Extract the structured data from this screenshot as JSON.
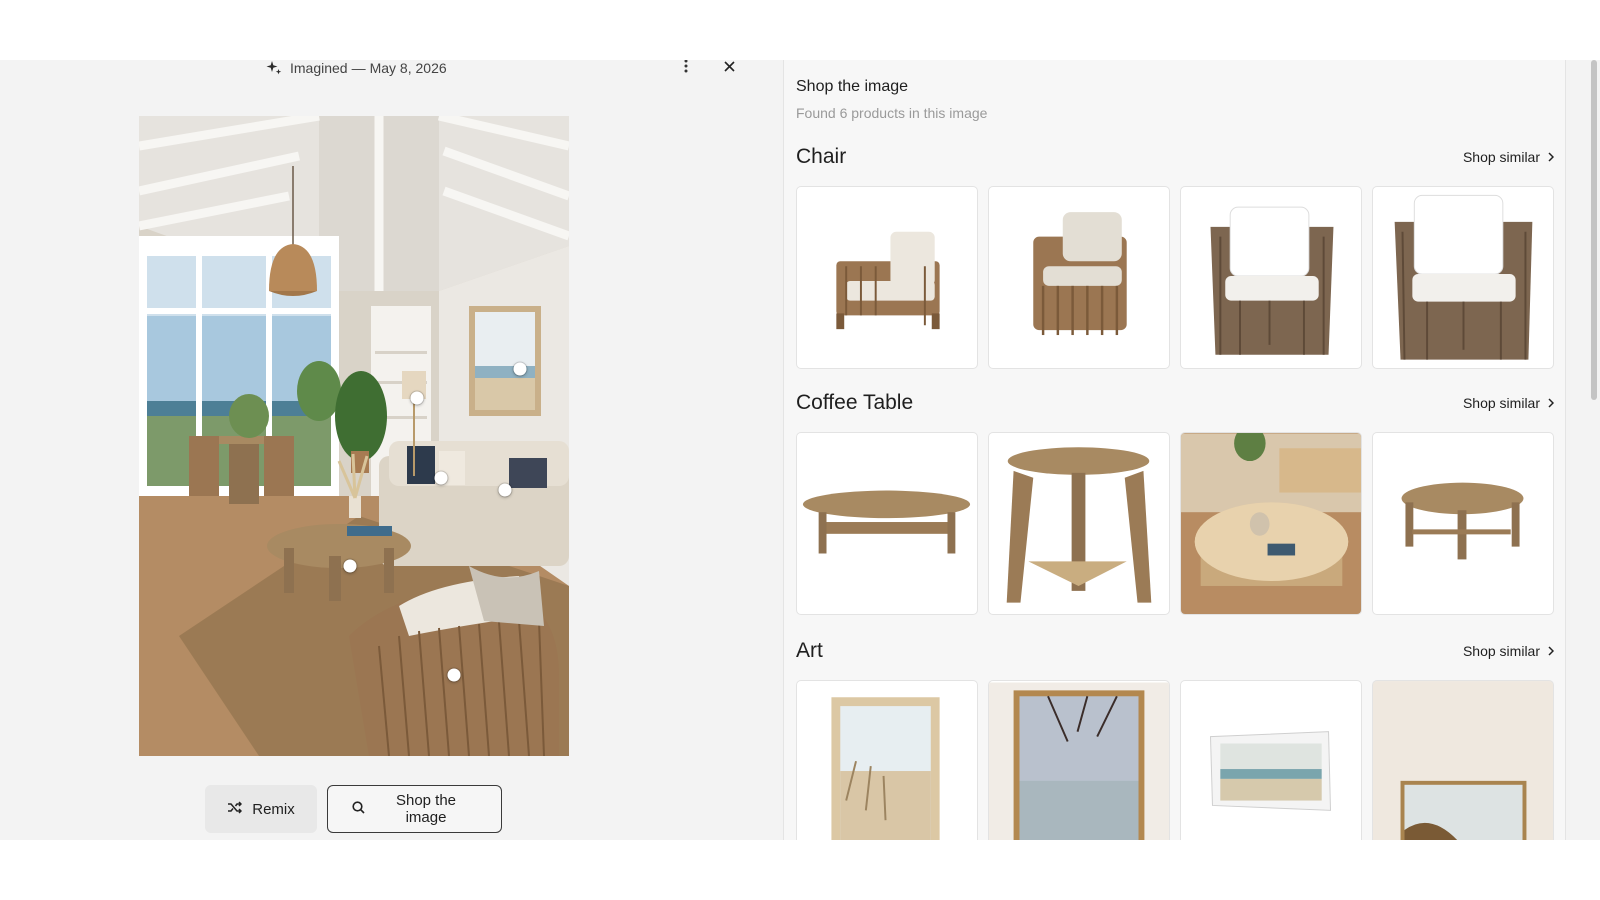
{
  "viewer": {
    "imagined_label": "Imagined",
    "separator": "—",
    "date": "May 8, 2026",
    "more_icon": "more-vertical-icon",
    "close_icon": "close-icon",
    "remix_label": "Remix",
    "remix_icon": "shuffle-icon",
    "shop_label": "Shop the image",
    "shop_icon": "search-icon"
  },
  "panel": {
    "title": "Shop the image",
    "subtitle": "Found 6 products in this image",
    "sections": [
      {
        "title": "Chair",
        "link": "Shop similar",
        "link_icon": "chevron-right-icon"
      },
      {
        "title": "Coffee Table",
        "link": "Shop similar",
        "link_icon": "chevron-right-icon"
      },
      {
        "title": "Art",
        "link": "Shop similar",
        "link_icon": "chevron-right-icon"
      }
    ]
  },
  "colors": {
    "stage_bg": "#f3f3f3",
    "panel_bg": "#f7f7f7",
    "rattan": "#9b7652",
    "cushion": "#ece7de",
    "wood": "#a88a62"
  }
}
